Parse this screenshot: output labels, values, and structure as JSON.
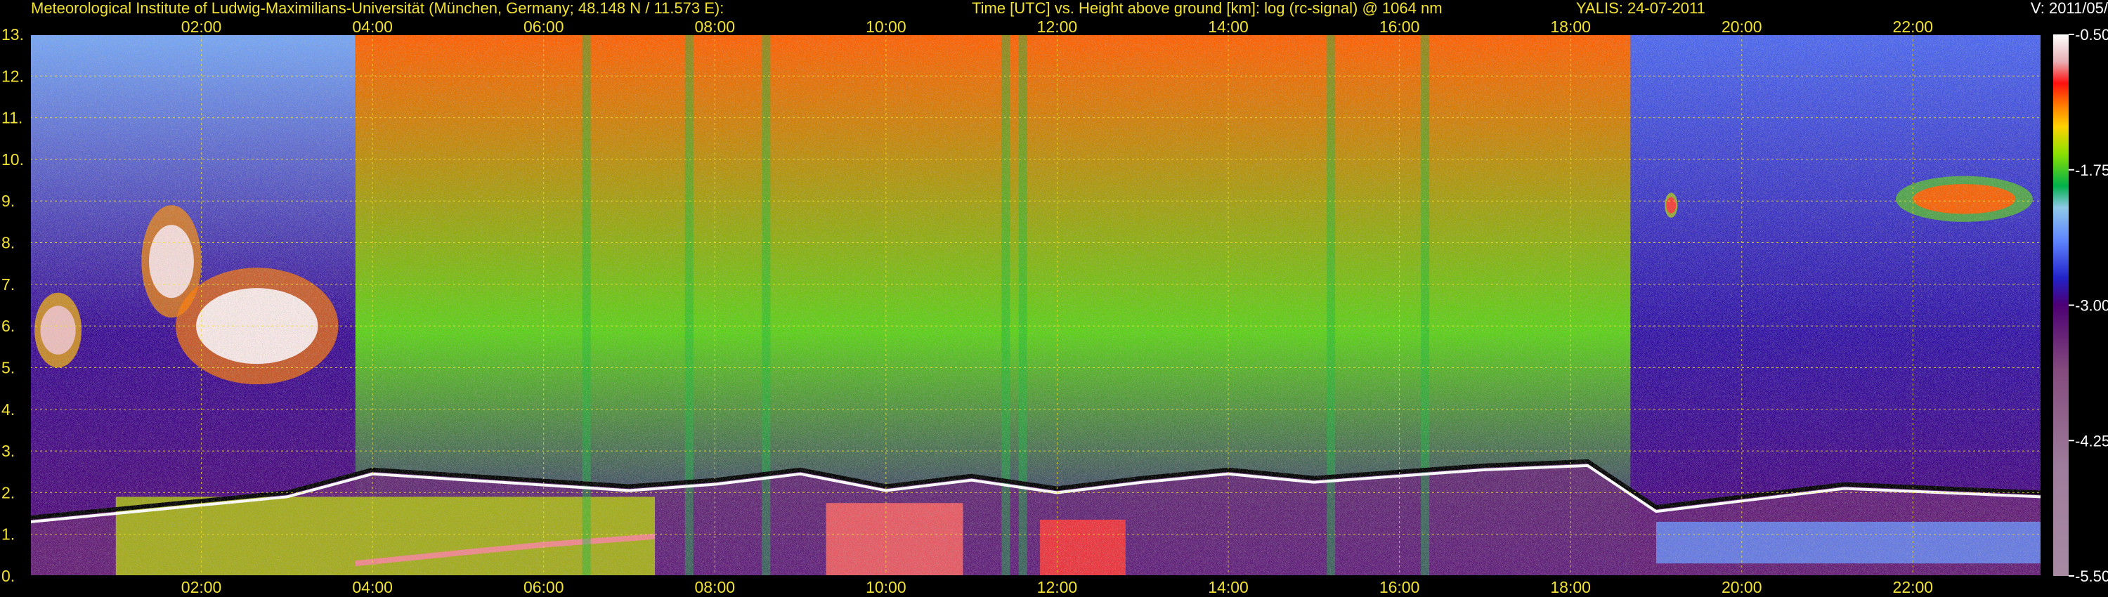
{
  "header": {
    "institute": "Meteorological Institute of Ludwig-Maximilians-Universität (München, Germany; 48.148 N / 11.573 E):",
    "axes_description": "Time [UTC] vs. Height above ground [km]: log (rc-signal) @ 1064 nm",
    "instrument_date": "YALIS: 24-07-2011",
    "version": "V: 2011/05/"
  },
  "chart_data": {
    "type": "heatmap",
    "title": "Time [UTC] vs. Height above ground [km]: log (rc-signal) @ 1064 nm",
    "x": {
      "min": 0.0,
      "max": 23.5,
      "ticks": [
        2,
        4,
        6,
        8,
        10,
        12,
        14,
        16,
        18,
        20,
        22
      ],
      "tick_labels": [
        "02:00",
        "04:00",
        "06:00",
        "08:00",
        "10:00",
        "12:00",
        "14:00",
        "16:00",
        "18:00",
        "20:00",
        "22:00"
      ]
    },
    "y": {
      "min": 0,
      "max": 13,
      "ticks": [
        0,
        1,
        2,
        3,
        4,
        5,
        6,
        7,
        8,
        9,
        10,
        11,
        12,
        13
      ],
      "tick_labels": [
        "0.",
        "1.",
        "2.",
        "3.",
        "4.",
        "5.",
        "6.",
        "7.",
        "8.",
        "9.",
        "10.",
        "11.",
        "12.",
        "13."
      ]
    },
    "grid": true,
    "colorbar": {
      "min": -5.5,
      "max": -0.5,
      "ticks": [
        -0.5,
        -1.75,
        -3.0,
        -4.25,
        -5.5
      ],
      "tick_labels": [
        "-0.50",
        "-1.75",
        "-3.00",
        "-4.25",
        "-5.50"
      ],
      "colors": [
        [
          -5.5,
          "#a88aa3"
        ],
        [
          -4.5,
          "#9e7d9c"
        ],
        [
          -3.6,
          "#844b7d"
        ],
        [
          -3.0,
          "#4d0073"
        ],
        [
          -2.75,
          "#2222c8"
        ],
        [
          -2.4,
          "#5f86ff"
        ],
        [
          -2.1,
          "#8fc8e8"
        ],
        [
          -1.9,
          "#00b04a"
        ],
        [
          -1.6,
          "#8be000"
        ],
        [
          -1.35,
          "#ffd200"
        ],
        [
          -1.15,
          "#ff7a00"
        ],
        [
          -0.95,
          "#ff1010"
        ],
        [
          -0.75,
          "#e8b0b4"
        ],
        [
          -0.5,
          "#ffffff"
        ]
      ]
    },
    "features": {
      "background_bands": [
        {
          "t0": 0.0,
          "t1": 3.8,
          "value_top": -2.25,
          "value_mid": -2.9,
          "value_low": -3.1
        },
        {
          "t0": 3.8,
          "t1": 18.7,
          "value_top": -1.1,
          "value_mid": -1.7,
          "value_low": -2.9
        },
        {
          "t0": 18.7,
          "t1": 23.5,
          "value_top": -2.5,
          "value_mid": -2.85,
          "value_low": -3.05
        }
      ],
      "boundary_layer_top_km": [
        [
          0.0,
          1.4
        ],
        [
          1.0,
          1.6
        ],
        [
          3.0,
          2.0
        ],
        [
          4.0,
          2.55
        ],
        [
          5.5,
          2.35
        ],
        [
          7.0,
          2.15
        ],
        [
          8.0,
          2.3
        ],
        [
          9.0,
          2.55
        ],
        [
          10.0,
          2.15
        ],
        [
          11.0,
          2.4
        ],
        [
          12.0,
          2.1
        ],
        [
          13.0,
          2.35
        ],
        [
          14.0,
          2.55
        ],
        [
          15.0,
          2.35
        ],
        [
          16.0,
          2.5
        ],
        [
          17.0,
          2.65
        ],
        [
          18.2,
          2.75
        ],
        [
          19.0,
          1.65
        ],
        [
          20.0,
          1.9
        ],
        [
          21.2,
          2.2
        ],
        [
          23.5,
          2.0
        ]
      ],
      "low_aerosol_layer": {
        "t0": 1.0,
        "t1": 7.3,
        "top_km": 1.9,
        "value": -1.5
      },
      "residual_layer_km": [
        [
          3.8,
          0.3
        ],
        [
          5.0,
          0.55
        ],
        [
          6.0,
          0.75
        ],
        [
          7.0,
          0.9
        ],
        [
          7.3,
          0.95
        ]
      ],
      "cumulus_columns": [
        {
          "t0": 9.3,
          "t1": 10.9,
          "top_km": 1.75,
          "value": -0.85
        },
        {
          "t0": 11.8,
          "t1": 12.8,
          "top_km": 1.35,
          "value": -0.9
        }
      ],
      "cirrus_clouds": [
        {
          "t0": 0.05,
          "t1": 0.6,
          "z0": 5.0,
          "z1": 6.8,
          "value": -0.7
        },
        {
          "t0": 1.3,
          "t1": 2.0,
          "z0": 6.2,
          "z1": 8.9,
          "value": -0.6
        },
        {
          "t0": 1.7,
          "t1": 3.6,
          "z0": 4.6,
          "z1": 7.4,
          "value": -0.55
        },
        {
          "t0": 19.1,
          "t1": 19.25,
          "z0": 8.6,
          "z1": 9.2,
          "value": -0.9
        },
        {
          "t0": 21.8,
          "t1": 23.4,
          "z0": 8.5,
          "z1": 9.6,
          "value": -1.1
        }
      ],
      "elevated_layer_night": {
        "t0": 19.0,
        "t1": 23.5,
        "z0": 0.3,
        "z1": 1.3,
        "value": -2.35
      },
      "noisy_columns_h": [
        6.5,
        7.7,
        8.6,
        11.4,
        11.6,
        15.2,
        16.3
      ]
    }
  }
}
